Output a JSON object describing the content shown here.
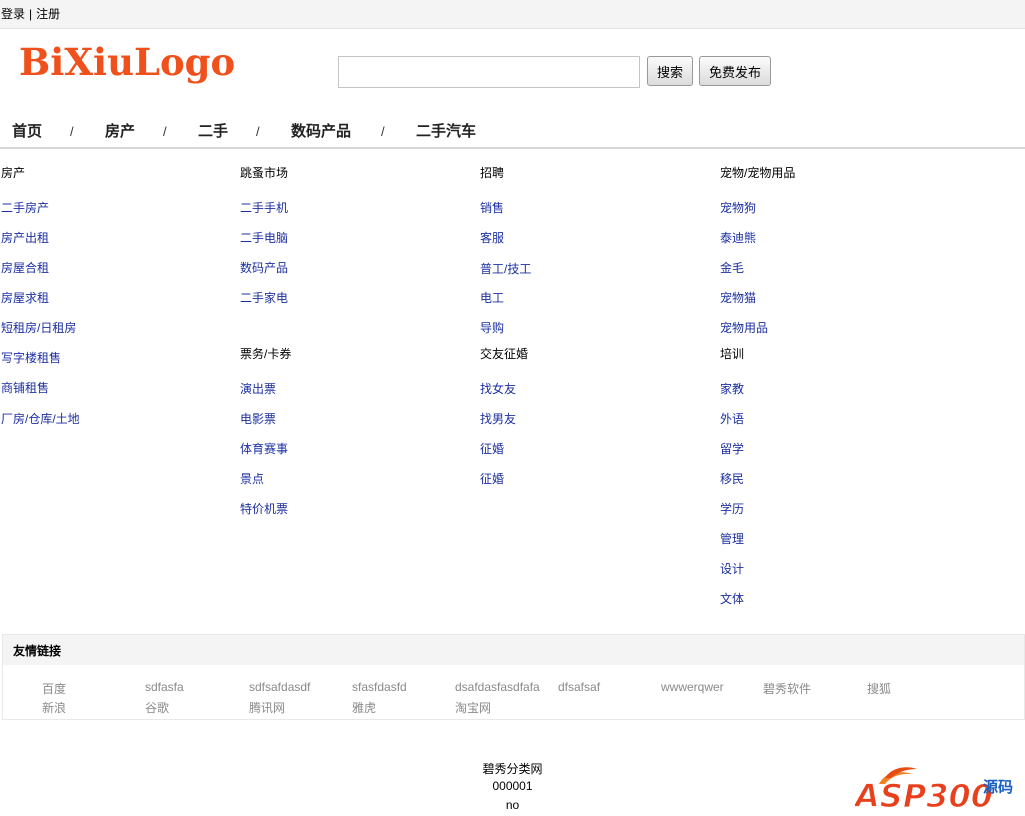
{
  "topbar": {
    "login": "登录",
    "separator": "|",
    "register": "注册"
  },
  "logo": {
    "text": "BiXiuLogo"
  },
  "search": {
    "value": "",
    "placeholder": "",
    "search_button": "搜索",
    "post_button": "免费发布"
  },
  "nav": {
    "items": [
      "首页",
      "房产",
      "二手",
      "数码产品",
      "二手汽车"
    ],
    "separator": "/"
  },
  "categories": [
    {
      "title": "房产",
      "links": [
        "二手房产",
        "房产出租",
        "房屋合租",
        "房屋求租",
        "短租房/日租房",
        "写字楼租售",
        "商铺租售",
        "厂房/仓库/土地"
      ]
    },
    {
      "title": "跳蚤市场",
      "links": [
        "二手手机",
        "二手电脑",
        "数码产品",
        "二手家电"
      ]
    },
    {
      "title": "票务/卡券",
      "links": [
        "演出票",
        "电影票",
        "体育赛事",
        "景点",
        "特价机票"
      ]
    },
    {
      "title": "招聘",
      "links": [
        "销售",
        "客服",
        "普工/技工",
        "电工",
        "导购"
      ]
    },
    {
      "title": "交友征婚",
      "links": [
        "找女友",
        "找男友",
        "征婚",
        "征婚"
      ]
    },
    {
      "title": "宠物/宠物用品",
      "links": [
        "宠物狗",
        "泰迪熊",
        "金毛",
        "宠物猫",
        "宠物用品"
      ]
    },
    {
      "title": "培训",
      "links": [
        "家教",
        "外语",
        "留学",
        "移民",
        "学历",
        "管理",
        "设计",
        "文体"
      ]
    }
  ],
  "friends": {
    "title": "友情链接",
    "links": [
      "百度",
      "sdfasfa",
      "sdfsafdasdf",
      "sfasfdasfd",
      "dsafdasfasdfafa",
      "dfsafsaf",
      "wwwerqwer",
      "碧秀软件",
      "搜狐",
      "新浪",
      "谷歌",
      "腾讯网",
      "雅虎",
      "淘宝网"
    ]
  },
  "footer": {
    "site_name": "碧秀分类网",
    "code": "000001",
    "note": "no"
  },
  "watermark": {
    "text": "ASP300",
    "suffix": "源码"
  },
  "colors": {
    "logo": "#f0501b",
    "link": "#1c2fa0",
    "friend_link": "#8a8a8a"
  }
}
